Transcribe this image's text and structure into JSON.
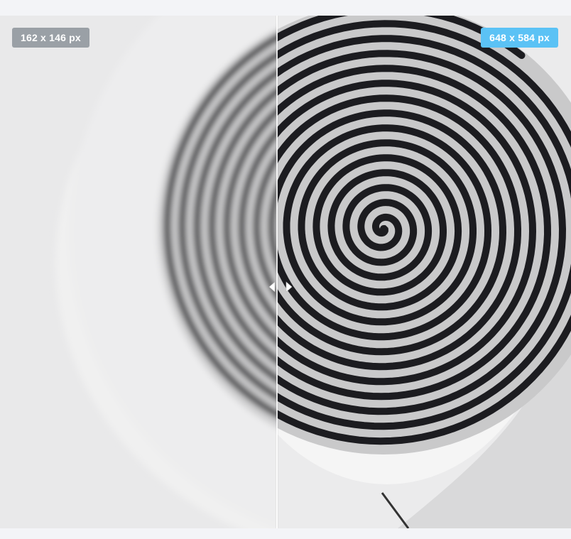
{
  "comparison": {
    "left_label": "162 x 146 px",
    "right_label": "648 x 584 px",
    "left_badge_color": "#9aa0a6",
    "right_badge_color": "#5bc2f5",
    "divider_position": 0.485
  },
  "icons": {
    "handle_left": "arrow-left-icon",
    "handle_right": "arrow-right-icon"
  }
}
